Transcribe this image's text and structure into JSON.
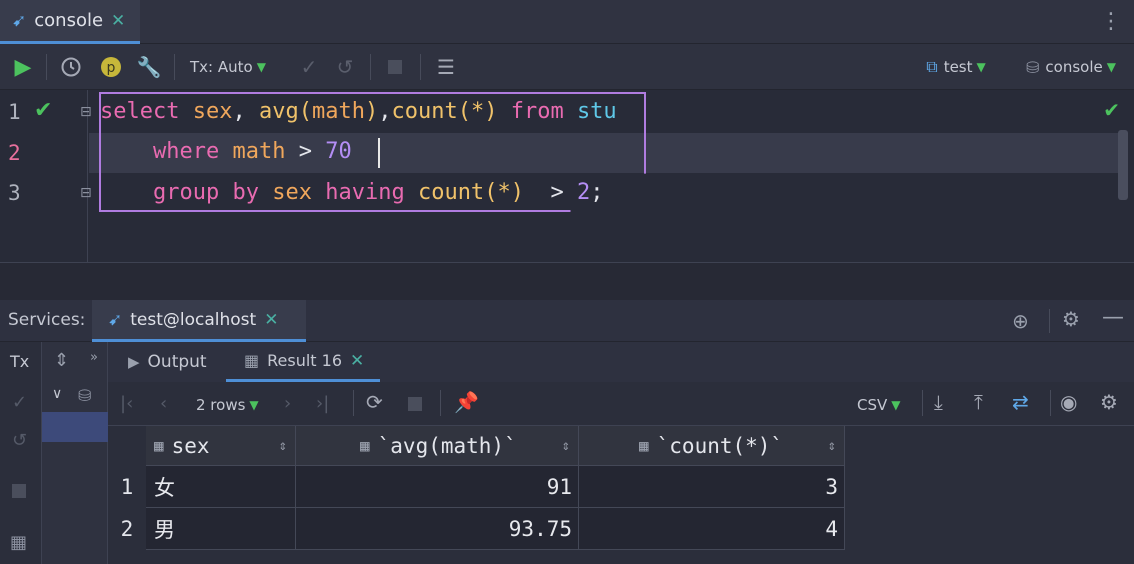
{
  "editor_tab": {
    "label": "console",
    "close": "✕"
  },
  "toolbar": {
    "tx_mode": "Tx: Auto",
    "datasource": "test",
    "session": "console"
  },
  "code": {
    "line_numbers": [
      "1",
      "2",
      "3"
    ],
    "line1": {
      "select": "select",
      "sex": "sex",
      "comma1": ", ",
      "avg": "avg",
      "open1": "(",
      "math": "math",
      "close1": ")",
      "comma2": ",",
      "count": "count",
      "open2": "(",
      "star": "*",
      "close2": ")",
      "from": "from",
      "stu": "stu"
    },
    "line2": {
      "where": "where",
      "math": "math",
      "gt": ">",
      "value": "70"
    },
    "line3": {
      "group": "group",
      "by": "by",
      "sex": "sex",
      "having": "having",
      "count": "count",
      "open": "(",
      "star": "*",
      "close": ")",
      "gt": ">",
      "value": "2",
      "semi": ";"
    }
  },
  "services": {
    "label": "Services:",
    "tab": "test@localhost",
    "tx_label": "Tx"
  },
  "result_panel": {
    "output_tab": "Output",
    "result_tab": "Result 16",
    "rows_label": "2 rows",
    "export_format": "CSV"
  },
  "table": {
    "columns": [
      "sex",
      "`avg(math)`",
      "`count(*)`"
    ],
    "rows": [
      {
        "num": "1",
        "sex": "女",
        "avg": "91",
        "count": "3"
      },
      {
        "num": "2",
        "sex": "男",
        "avg": "93.75",
        "count": "4"
      }
    ]
  },
  "colors": {
    "accent": "#4e8fd6",
    "run": "#4cc25e",
    "keyword": "#e96bb1",
    "identifier": "#f0a75c",
    "number": "#b48ef5",
    "selection": "#b07ce0"
  }
}
